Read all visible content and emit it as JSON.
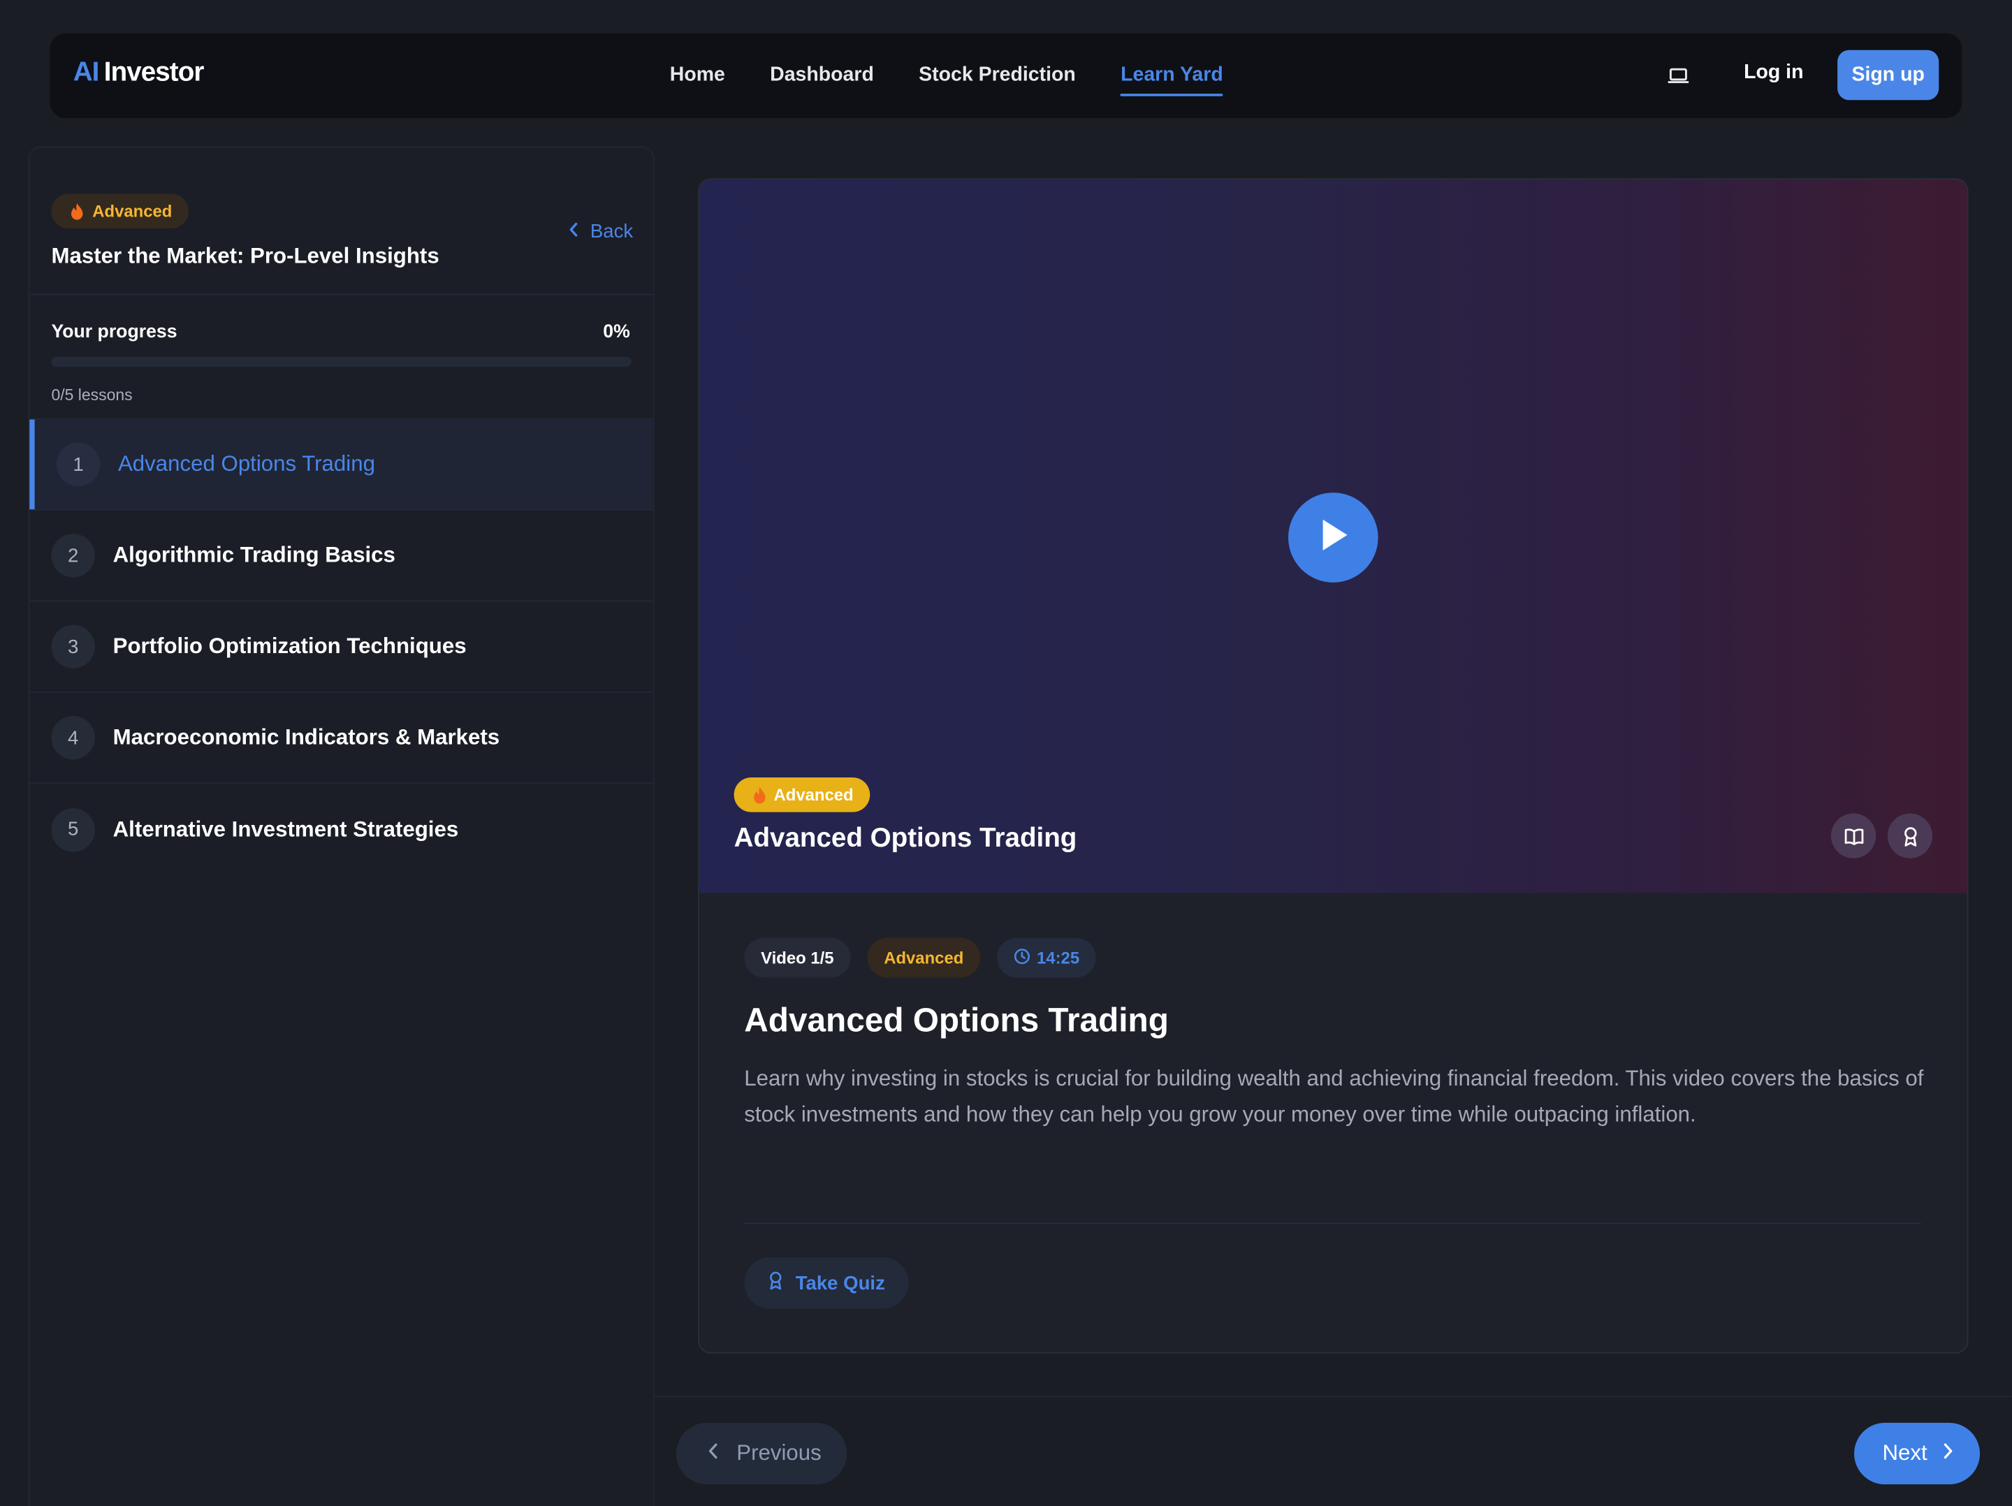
{
  "brand": {
    "ai": "AI",
    "name": "Investor"
  },
  "nav": {
    "links": [
      {
        "label": "Home"
      },
      {
        "label": "Dashboard"
      },
      {
        "label": "Stock Prediction"
      },
      {
        "label": "Learn Yard"
      }
    ],
    "active_index": 3,
    "login_label": "Log in",
    "signup_label": "Sign up"
  },
  "sidebar": {
    "level_badge": "Advanced",
    "course_title": "Master the Market: Pro-Level Insights",
    "back_label": "Back",
    "progress": {
      "label": "Your progress",
      "percent_text": "0%",
      "value": 0,
      "lessons_text": "0/5 lessons"
    },
    "lessons": [
      {
        "num": "1",
        "title": "Advanced Options Trading"
      },
      {
        "num": "2",
        "title": "Algorithmic Trading Basics"
      },
      {
        "num": "3",
        "title": "Portfolio Optimization Techniques"
      },
      {
        "num": "4",
        "title": "Macroeconomic Indicators & Markets"
      },
      {
        "num": "5",
        "title": "Alternative Investment Strategies"
      }
    ],
    "active_lesson_index": 0
  },
  "video": {
    "level_badge": "Advanced",
    "title": "Advanced Options Trading"
  },
  "details": {
    "tag_video": "Video 1/5",
    "tag_level": "Advanced",
    "tag_duration": "14:25",
    "heading": "Advanced Options Trading",
    "description": "Learn why investing in stocks is crucial for building wealth and achieving financial freedom. This video covers the basics of stock investments and how they can help you grow your money over time while outpacing inflation.",
    "quiz_label": "Take Quiz"
  },
  "footer": {
    "prev_label": "Previous",
    "next_label": "Next"
  },
  "colors": {
    "accent": "#4a86e8",
    "badge_amber": "#f5b731",
    "background": "#1a1d24"
  }
}
